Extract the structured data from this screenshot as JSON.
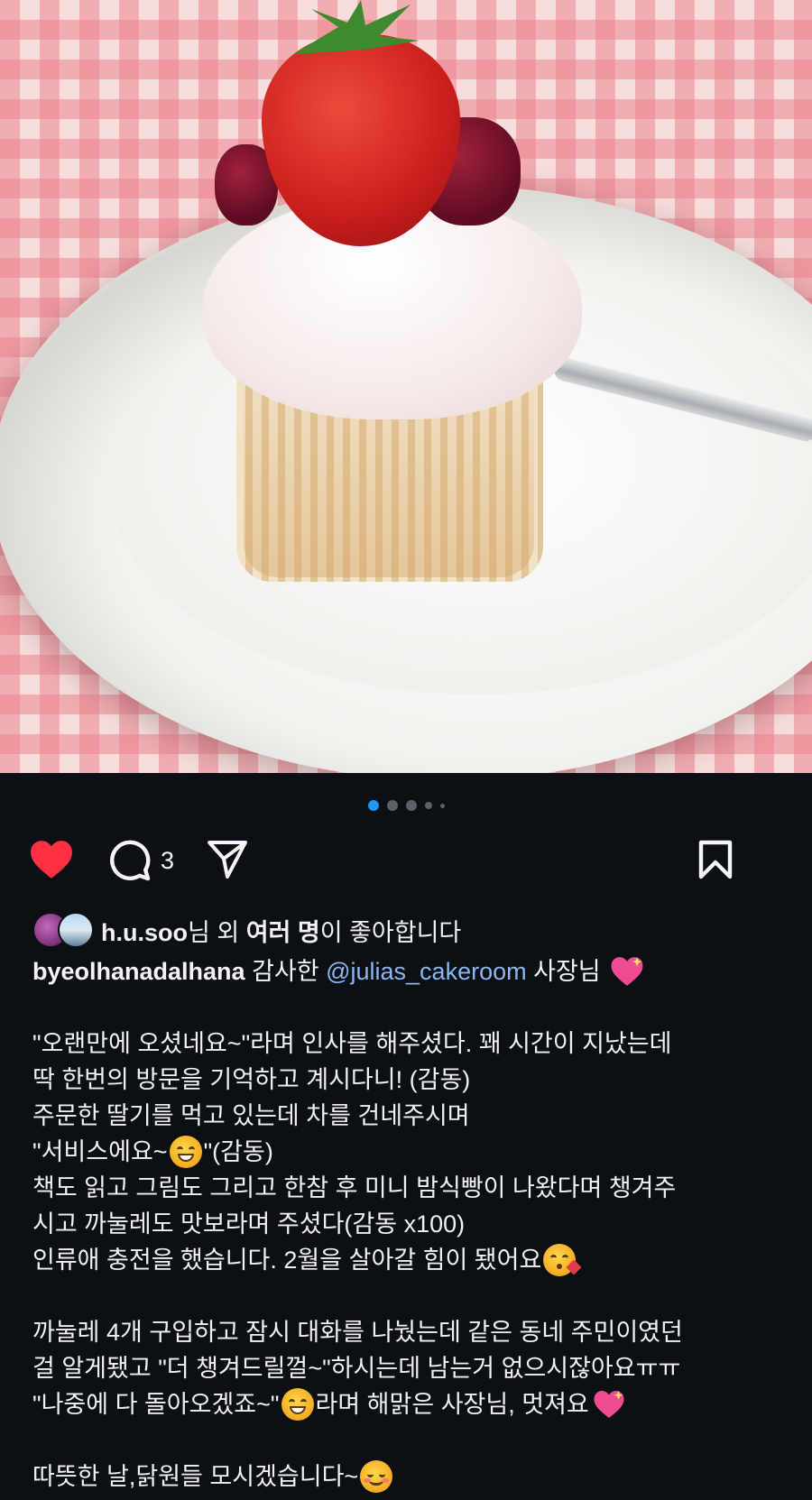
{
  "post": {
    "carousel": {
      "count": 5,
      "active_index": 0
    },
    "actions": {
      "like_icon": "heart-filled-icon",
      "comment_icon": "comment-bubble-icon",
      "comment_count": "3",
      "share_icon": "paper-plane-icon",
      "save_icon": "bookmark-icon",
      "like_color": "#ff3040",
      "accent_color": "#2196f3",
      "mention_color": "#8ab8f0"
    },
    "likes": {
      "first_liker": "h.u.soo",
      "suffix_1": "님 외 ",
      "others": "여러 명",
      "suffix_2": "이 좋아합니다"
    },
    "caption": {
      "username": "byeolhanadalhana",
      "text_before_mention": " 감사한 ",
      "mention": "@julias_cakeroom",
      "text_after_mention": " 사장님",
      "lines": [
        "\"오랜만에 오셨네요~\"라며 인사를 해주셨다. 꽤 시간이 지났는데",
        "딱 한번의 방문을 기억하고 계시다니! (감동)",
        "주문한 딸기를 먹고 있는데 차를 건네주시며",
        "\"서비스에요~",
        "\"(감동)",
        "책도 읽고 그림도 그리고 한참 후 미니 밤식빵이 나왔다며 챙겨주",
        "시고 까눌레도 맛보라며 주셨다(감동 x100)",
        "인류애 충전을 했습니다. 2월을 살아갈 힘이 됐어요",
        "까눌레 4개 구입하고 잠시 대화를 나눴는데 같은 동네 주민이였던",
        "걸 알게됐고 \"더 챙겨드릴껄~\"하시는데 남는거 없으시잖아요ㅠㅠ",
        "\"나중에 다 돌아오겠죠~\"",
        "라며 해맑은 사장님, 멋져요",
        "따뜻한 날,닭원들 모시겠습니다~"
      ]
    }
  }
}
